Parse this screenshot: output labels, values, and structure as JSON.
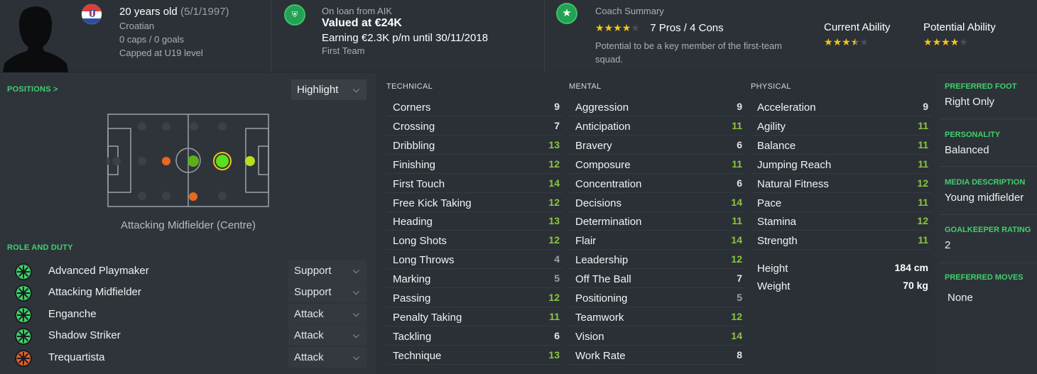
{
  "player": {
    "age_text": "20 years old",
    "dob": "(5/1/1997)",
    "nationality": "Croatian",
    "caps": "0 caps / 0 goals",
    "capped_level": "Capped at U19 level"
  },
  "contract": {
    "loan_text": "On loan from AIK",
    "value": "Valued at €24K",
    "earning": "Earning €2.3K p/m until 30/11/2018",
    "squad": "First Team"
  },
  "coach": {
    "title": "Coach Summary",
    "stars": 4,
    "pros_cons": "7 Pros / 4 Cons",
    "summary": "Potential to be a key member of the first-team squad.",
    "current_ability_label": "Current Ability",
    "current_ability_stars": 3.5,
    "potential_ability_label": "Potential Ability",
    "potential_ability_stars": 4
  },
  "positions": {
    "label": "POSITIONS >",
    "highlight": "Highlight",
    "position_name": "Attacking Midfielder (Centre)"
  },
  "roles": {
    "label": "ROLE AND DUTY",
    "items": [
      {
        "name": "Advanced Playmaker",
        "duty": "Support",
        "color": "#3fd16b"
      },
      {
        "name": "Attacking Midfielder",
        "duty": "Support",
        "color": "#3fd16b"
      },
      {
        "name": "Enganche",
        "duty": "Attack",
        "color": "#3fd16b"
      },
      {
        "name": "Shadow Striker",
        "duty": "Attack",
        "color": "#3fd16b"
      },
      {
        "name": "Trequartista",
        "duty": "Attack",
        "color": "#e0602a"
      }
    ]
  },
  "attributes": {
    "technical": {
      "label": "TECHNICAL",
      "items": [
        {
          "name": "Corners",
          "value": 9
        },
        {
          "name": "Crossing",
          "value": 7
        },
        {
          "name": "Dribbling",
          "value": 13
        },
        {
          "name": "Finishing",
          "value": 12
        },
        {
          "name": "First Touch",
          "value": 14
        },
        {
          "name": "Free Kick Taking",
          "value": 12
        },
        {
          "name": "Heading",
          "value": 13
        },
        {
          "name": "Long Shots",
          "value": 12
        },
        {
          "name": "Long Throws",
          "value": 4
        },
        {
          "name": "Marking",
          "value": 5
        },
        {
          "name": "Passing",
          "value": 12
        },
        {
          "name": "Penalty Taking",
          "value": 11
        },
        {
          "name": "Tackling",
          "value": 6
        },
        {
          "name": "Technique",
          "value": 13
        }
      ]
    },
    "mental": {
      "label": "MENTAL",
      "items": [
        {
          "name": "Aggression",
          "value": 9
        },
        {
          "name": "Anticipation",
          "value": 11
        },
        {
          "name": "Bravery",
          "value": 6
        },
        {
          "name": "Composure",
          "value": 11
        },
        {
          "name": "Concentration",
          "value": 6
        },
        {
          "name": "Decisions",
          "value": 14
        },
        {
          "name": "Determination",
          "value": 11
        },
        {
          "name": "Flair",
          "value": 14
        },
        {
          "name": "Leadership",
          "value": 12
        },
        {
          "name": "Off The Ball",
          "value": 7
        },
        {
          "name": "Positioning",
          "value": 5
        },
        {
          "name": "Teamwork",
          "value": 12
        },
        {
          "name": "Vision",
          "value": 14
        },
        {
          "name": "Work Rate",
          "value": 8
        }
      ]
    },
    "physical": {
      "label": "PHYSICAL",
      "items": [
        {
          "name": "Acceleration",
          "value": 9
        },
        {
          "name": "Agility",
          "value": 11
        },
        {
          "name": "Balance",
          "value": 11
        },
        {
          "name": "Jumping Reach",
          "value": 11
        },
        {
          "name": "Natural Fitness",
          "value": 12
        },
        {
          "name": "Pace",
          "value": 11
        },
        {
          "name": "Stamina",
          "value": 12
        },
        {
          "name": "Strength",
          "value": 11
        }
      ],
      "height_label": "Height",
      "height": "184 cm",
      "weight_label": "Weight",
      "weight": "70 kg"
    }
  },
  "info": {
    "preferred_foot_label": "PREFERRED FOOT",
    "preferred_foot": "Right Only",
    "personality_label": "PERSONALITY",
    "personality": "Balanced",
    "media_label": "MEDIA DESCRIPTION",
    "media": "Young midfielder",
    "gk_label": "GOALKEEPER RATING",
    "gk": "2",
    "moves_label": "PREFERRED MOVES",
    "moves": "None"
  }
}
